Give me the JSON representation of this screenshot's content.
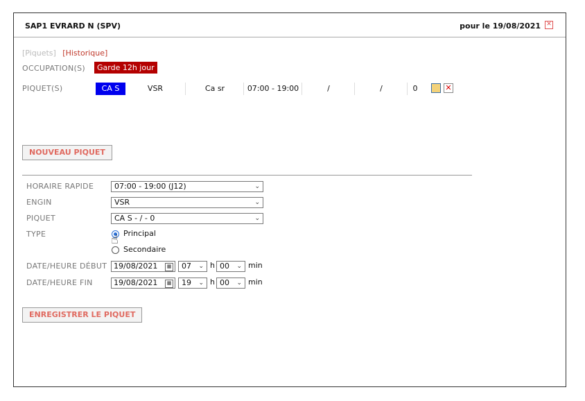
{
  "header": {
    "title": "SAP1 EVRARD N (SPV)",
    "date_label": "pour le 19/08/2021",
    "close_icon": "close-icon"
  },
  "links": {
    "piquets": "[Piquets]",
    "historique": "[Historique]"
  },
  "occupation": {
    "label": "OCCUPATION(S)",
    "badge": "Garde 12h jour",
    "badge_color": "#b40000"
  },
  "piquets": {
    "label": "PIQUET(S)",
    "row": {
      "cas": "CA S",
      "engin": "VSR",
      "role": "Ca sr",
      "hours": "07:00 - 19:00",
      "slash1": "/",
      "slash2": "/",
      "count": "0"
    },
    "highlight_color": "#0000ee"
  },
  "buttons": {
    "nouveau": "NOUVEAU PIQUET",
    "enregistrer": "ENREGISTRER LE PIQUET"
  },
  "form": {
    "horaire": {
      "label": "HORAIRE RAPIDE",
      "value": "07:00 - 19:00 (J12)"
    },
    "engin": {
      "label": "ENGIN",
      "value": "VSR"
    },
    "piquet": {
      "label": "PIQUET",
      "value": "CA S - / - 0"
    },
    "type": {
      "label": "TYPE",
      "principal": "Principal",
      "secondaire": "Secondaire",
      "selected": "Principal"
    },
    "debut": {
      "label": "DATE/HEURE DÉBUT",
      "date": "19/08/2021",
      "hour": "07",
      "minute": "00"
    },
    "fin": {
      "label": "DATE/HEURE FIN",
      "date": "19/08/2021",
      "hour": "19",
      "minute": "00"
    },
    "units": {
      "h": "h",
      "min": "min"
    }
  }
}
